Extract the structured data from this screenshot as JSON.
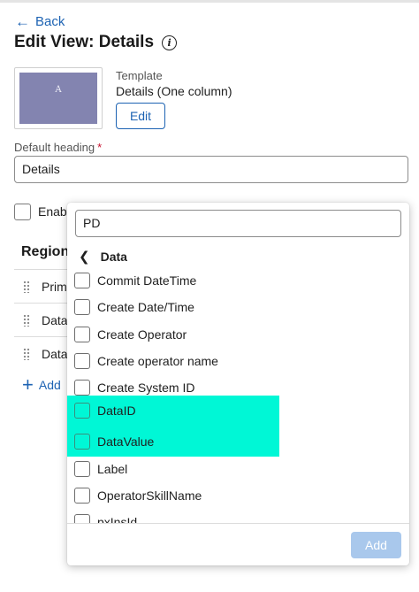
{
  "header": {
    "back_label": "Back",
    "title": "Edit View: Details"
  },
  "template": {
    "label": "Template",
    "value": "Details (One column)",
    "thumbnail_letter": "A",
    "edit_label": "Edit"
  },
  "default_heading": {
    "label": "Default heading",
    "required_marker": "*",
    "value": "Details"
  },
  "background": {
    "checkbox_label": "Enab"
  },
  "regions": {
    "heading": "Region",
    "rows": [
      "Prima",
      "Data",
      "DataV"
    ],
    "add_label": "Add"
  },
  "popover": {
    "search_value": "PD",
    "breadcrumb": "Data",
    "items": [
      {
        "label": "Commit DateTime",
        "highlighted": false
      },
      {
        "label": "Create Date/Time",
        "highlighted": false
      },
      {
        "label": "Create Operator",
        "highlighted": false
      },
      {
        "label": "Create operator name",
        "highlighted": false
      },
      {
        "label": "Create System ID",
        "highlighted": false
      },
      {
        "label": "DataID",
        "highlighted": true
      },
      {
        "label": "DataValue",
        "highlighted": true
      },
      {
        "label": "Label",
        "highlighted": false
      },
      {
        "label": "OperatorSkillName",
        "highlighted": false
      },
      {
        "label": "pxInsId",
        "highlighted": false
      }
    ],
    "add_button_label": "Add"
  },
  "colors": {
    "accent": "#1d63b3",
    "highlight": "#00f7d6",
    "disabled_button": "#a9c8ec",
    "required": "#c8102e"
  }
}
